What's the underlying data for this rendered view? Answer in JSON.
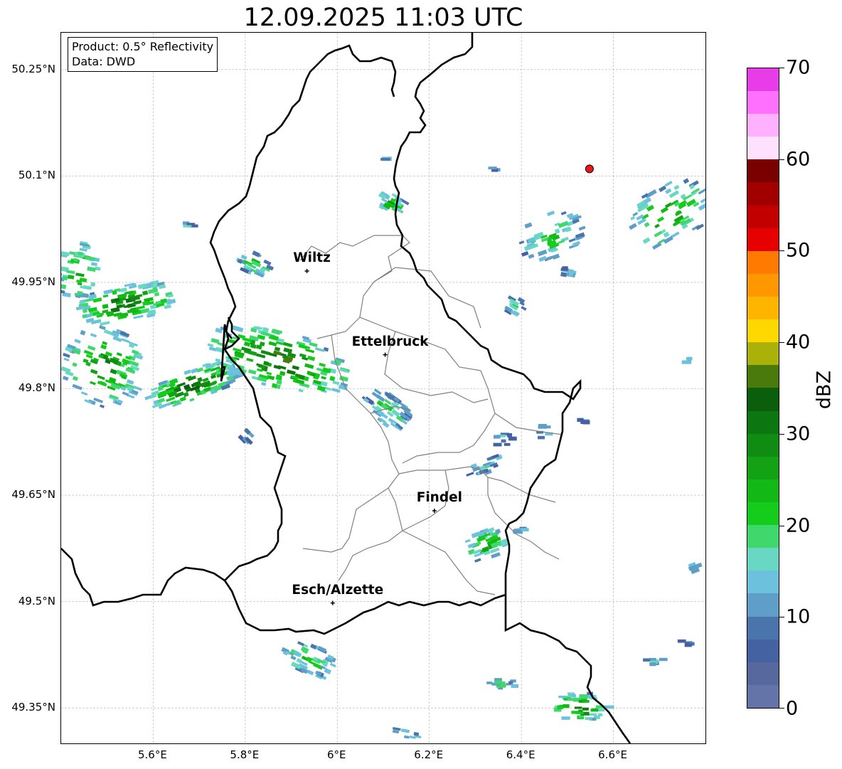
{
  "title": "12.09.2025 11:03 UTC",
  "info": {
    "product": "Product: 0.5° Reflectivity",
    "data": "Data: DWD"
  },
  "lat_labels": [
    "50.25°N",
    "50.1°N",
    "49.95°N",
    "49.8°N",
    "49.65°N",
    "49.5°N",
    "49.35°N"
  ],
  "lon_labels": [
    "5.6°E",
    "5.8°E",
    "6°E",
    "6.2°E",
    "6.4°E",
    "6.6°E"
  ],
  "cities": [
    {
      "name": "Wiltz",
      "lon": 5.934,
      "lat": 49.966
    },
    {
      "name": "Ettelbruck",
      "lon": 6.104,
      "lat": 49.848
    },
    {
      "name": "Findel",
      "lon": 6.211,
      "lat": 49.628
    },
    {
      "name": "Esch/Alzette",
      "lon": 5.99,
      "lat": 49.498
    }
  ],
  "radar_site": {
    "lon": 6.548,
    "lat": 50.11,
    "color": "#e8191c"
  },
  "colorbar": {
    "title": "dBZ",
    "min": 0,
    "max": 70,
    "step": 2.5,
    "tick_labels": [
      "0",
      "10",
      "20",
      "30",
      "40",
      "50",
      "60",
      "70"
    ],
    "colors": [
      "#6474a8",
      "#56689e",
      "#4462a2",
      "#4a74ac",
      "#5e9ec8",
      "#6cc2dc",
      "#68d8c4",
      "#3ed86c",
      "#14cc1c",
      "#12b814",
      "#12a214",
      "#108c12",
      "#0c7610",
      "#0a5e0c",
      "#4a7a0c",
      "#aab20a",
      "#ffd800",
      "#ffb400",
      "#ff9800",
      "#ff7a00",
      "#e60000",
      "#c20000",
      "#a20000",
      "#7a0000",
      "#ffe0ff",
      "#ffb0ff",
      "#ff70ff",
      "#e83ce8"
    ]
  },
  "map_colors": {
    "border": "#000000",
    "canton": "#808080",
    "grid": "#b0b0b0"
  }
}
